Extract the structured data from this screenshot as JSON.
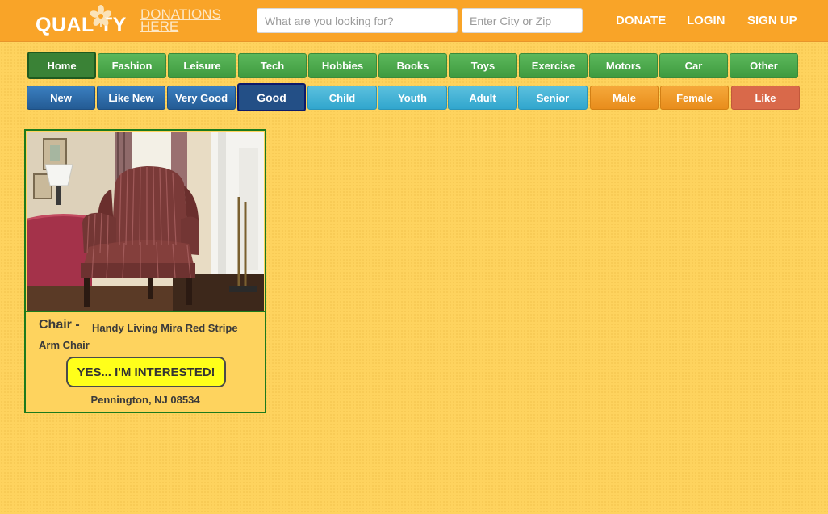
{
  "header": {
    "logo_main": "QUAL TY",
    "logo_sub": "DONATIONS HERE",
    "search": {
      "placeholder": "What are you looking for?",
      "value": ""
    },
    "city": {
      "placeholder": "Enter City or Zip",
      "value": ""
    },
    "nav": {
      "donate": "DONATE",
      "login": "LOGIN",
      "signup": "SIGN UP"
    }
  },
  "categories": [
    {
      "label": "Home",
      "active": true
    },
    {
      "label": "Fashion"
    },
    {
      "label": "Leisure"
    },
    {
      "label": "Tech"
    },
    {
      "label": "Hobbies"
    },
    {
      "label": "Books"
    },
    {
      "label": "Toys"
    },
    {
      "label": "Exercise"
    },
    {
      "label": "Motors"
    },
    {
      "label": "Car"
    },
    {
      "label": "Other"
    }
  ],
  "filters": [
    {
      "label": "New",
      "group": "condition"
    },
    {
      "label": "Like New",
      "group": "condition"
    },
    {
      "label": "Very Good",
      "group": "condition"
    },
    {
      "label": "Good",
      "group": "condition",
      "selected": true
    },
    {
      "label": "Child",
      "group": "age"
    },
    {
      "label": "Youth",
      "group": "age"
    },
    {
      "label": "Adult",
      "group": "age"
    },
    {
      "label": "Senior",
      "group": "age"
    },
    {
      "label": "Male",
      "group": "gender"
    },
    {
      "label": "Female",
      "group": "gender"
    },
    {
      "label": "Like",
      "group": "like"
    }
  ],
  "listing": {
    "category": "Chair -",
    "title": "Handy Living Mira Red Stripe Arm Chair",
    "interest_button": "YES... I'M INTERESTED!",
    "location": "Pennington, NJ 08534"
  },
  "colors": {
    "page_bg": "#fed35e",
    "header_bg": "#f9a428",
    "green": "#3f9a3f",
    "blue": "#245b94",
    "cyan": "#31a6cd",
    "orange": "#e88d1c",
    "red": "#d9694a",
    "interest_yellow": "#ffff1a",
    "card_border": "#1c7a1c"
  }
}
